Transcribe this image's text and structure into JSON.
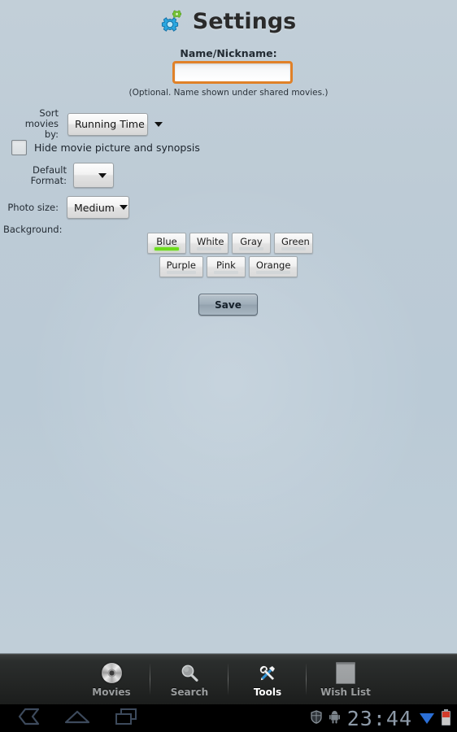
{
  "header": {
    "title": "Settings",
    "icon": "gears-icon"
  },
  "form": {
    "name_label": "Name/Nickname:",
    "name_value": "",
    "name_placeholder": "",
    "name_hint": "(Optional. Name shown under shared movies.)",
    "sort_label_line1": "Sort movies",
    "sort_label_line2": "by:",
    "sort_value": "Running Time",
    "hide_checkbox_label": "Hide movie picture and synopsis",
    "hide_checkbox_checked": false,
    "default_format_label": "Default Format:",
    "default_format_value": "",
    "photo_size_label": "Photo size:",
    "photo_size_value": "Medium",
    "background_label": "Background:",
    "save_label": "Save"
  },
  "background_tabs": {
    "selected": "Blue",
    "selected_color": "#6ddc1c",
    "row1": [
      "Blue",
      "White",
      "Gray",
      "Green"
    ],
    "row2": [
      "Purple",
      "Pink",
      "Orange"
    ]
  },
  "bottom_nav": {
    "active": "Tools",
    "items": [
      {
        "label": "Movies",
        "icon": "disc-icon"
      },
      {
        "label": "Search",
        "icon": "magnifier-icon"
      },
      {
        "label": "Tools",
        "icon": "tools-icon"
      },
      {
        "label": "Wish List",
        "icon": "list-icon"
      }
    ]
  },
  "system_bar": {
    "back": "back-icon",
    "home": "home-icon",
    "recents": "recents-icon",
    "shield": "shield-icon",
    "android": "android-icon",
    "clock": "23:44",
    "wifi": "wifi-icon",
    "battery": "battery-icon"
  },
  "colors": {
    "accent_orange": "#e08128",
    "select_green": "#6ddc1c",
    "background": "#bdcbd6"
  }
}
